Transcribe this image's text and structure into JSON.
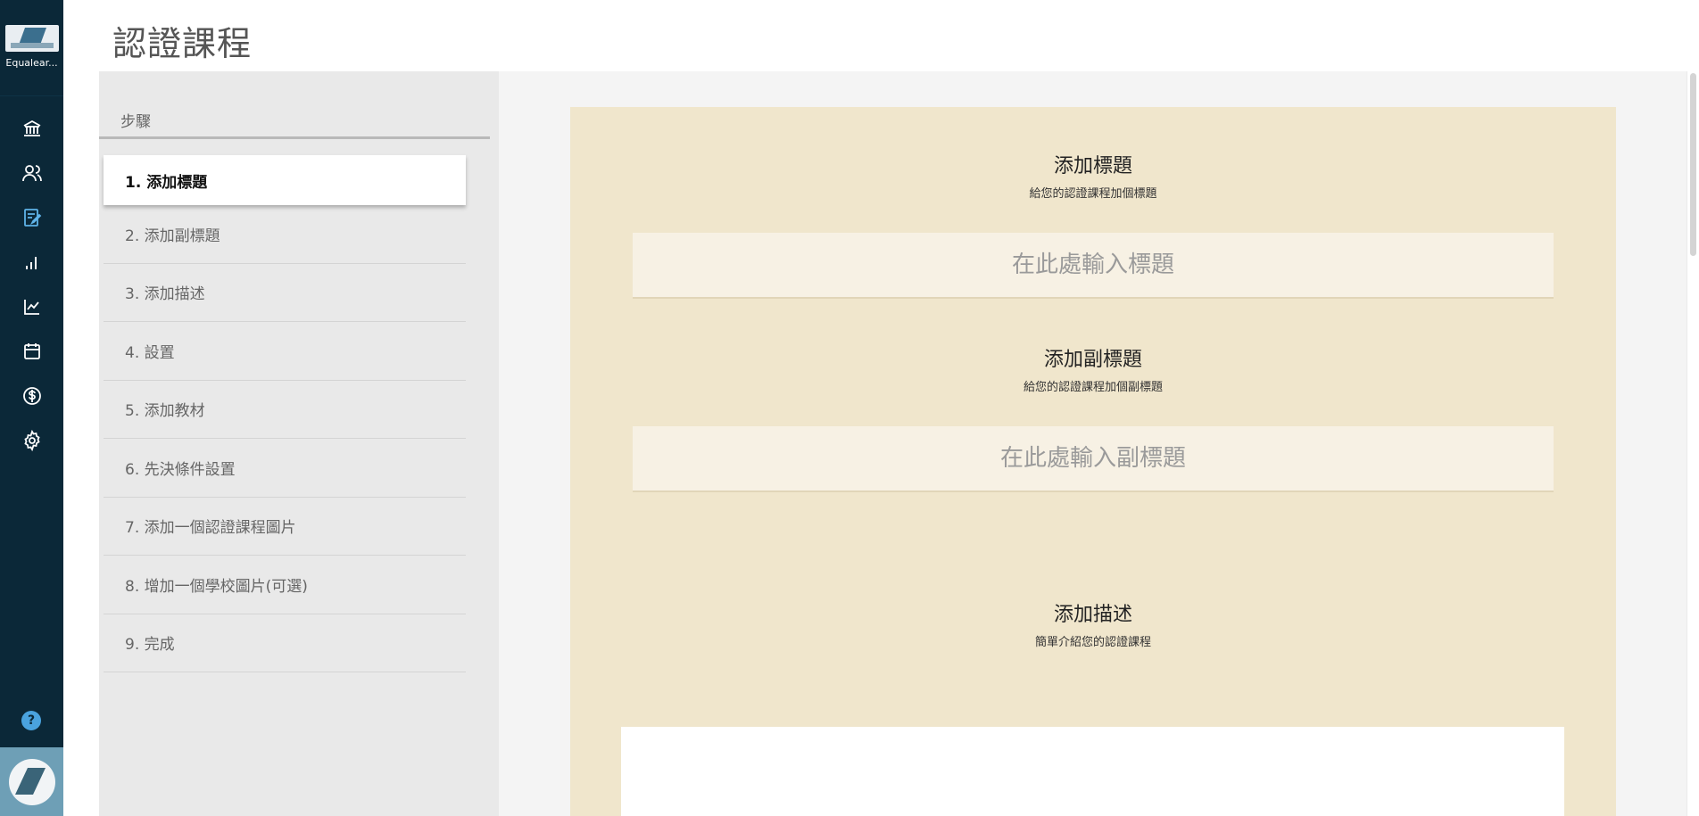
{
  "brand": {
    "label": "Equalear..."
  },
  "page": {
    "title": "認證課程"
  },
  "steps": {
    "header": "步驟",
    "items": [
      {
        "label": "1. 添加標題"
      },
      {
        "label": "2. 添加副標題"
      },
      {
        "label": "3. 添加描述"
      },
      {
        "label": "4. 設置"
      },
      {
        "label": "5. 添加教材"
      },
      {
        "label": "6. 先決條件設置"
      },
      {
        "label": "7. 添加一個認證課程圖片"
      },
      {
        "label": "8. 增加一個學校圖片(可選)"
      },
      {
        "label": "9. 完成"
      }
    ],
    "active_index": 0
  },
  "form": {
    "title_section": {
      "heading": "添加標題",
      "subheading": "給您的認證課程加個標題",
      "placeholder": "在此處輸入標題"
    },
    "subtitle_section": {
      "heading": "添加副標題",
      "subheading": "給您的認證課程加個副標題",
      "placeholder": "在此處輸入副標題"
    },
    "description_section": {
      "heading": "添加描述",
      "subheading": "簡單介紹您的認證課程"
    }
  },
  "rail": {
    "icons": [
      "institution-icon",
      "users-icon",
      "edit-document-icon",
      "bar-chart-icon",
      "line-chart-icon",
      "calendar-icon",
      "dollar-icon",
      "settings-gear-icon"
    ],
    "active_icon": "edit-document-icon",
    "help_label": "?"
  },
  "colors": {
    "rail_bg": "#0b2838",
    "active_icon": "#5fb3e8",
    "form_card": "#f0e6cc",
    "input_bg": "#f7f1e4",
    "steps_panel": "#e9e9e9"
  }
}
